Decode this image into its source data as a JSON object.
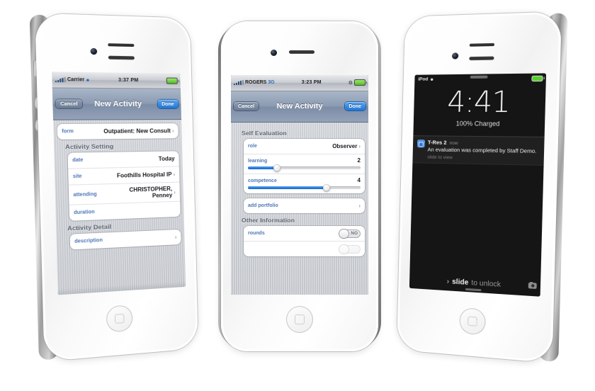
{
  "scene": {
    "title": "Three iPhone 4S mockups showing T-Res 2 app screens",
    "background": "#ffffff"
  },
  "phone_left": {
    "label": "iPhone showing New Activity form",
    "status_bar": {
      "carrier": "Carrier",
      "signal_icon": "signal-bars-icon",
      "wifi_icon": "wifi-icon",
      "time": "3:37 PM",
      "battery_icon": "battery-full-icon"
    },
    "nav": {
      "back_label": "Cancel",
      "title": "New Activity",
      "done_label": "Done"
    },
    "form_row": {
      "key": "form",
      "value": "Outpatient: New Consult",
      "chevron": "chevron-right-icon"
    },
    "sections": [
      {
        "header": "Activity Setting",
        "rows": [
          {
            "badge": "none",
            "key": "date",
            "value": "Today",
            "chevron": false
          },
          {
            "badge": "minus",
            "key": "site",
            "value": "Foothills Hospital IP",
            "chevron": true
          },
          {
            "badge": "minus",
            "key": "attending",
            "value": "CHRISTOPHER, Penney",
            "chevron": true
          },
          {
            "badge": "plus",
            "key": "duration",
            "value": "",
            "chevron": false
          }
        ]
      },
      {
        "header": "Activity Detail",
        "rows": [
          {
            "badge": "plus",
            "key": "description",
            "value": "",
            "chevron": true
          }
        ]
      }
    ]
  },
  "phone_center": {
    "label": "iPhone showing Self Evaluation screen",
    "status_bar": {
      "carrier": "ROGERS",
      "network": "3G",
      "signal_icon": "signal-bars-icon",
      "time": "3:23 PM",
      "bluetooth_icon": "bluetooth-icon",
      "battery_icon": "battery-full-icon"
    },
    "nav": {
      "back_label": "Cancel",
      "title": "New Activity",
      "done_label": "Done"
    },
    "sections": [
      {
        "header": "Self Evaluation",
        "rows": [
          {
            "type": "value",
            "badge": "minus",
            "key": "role",
            "value": "Observer",
            "chevron": true
          },
          {
            "type": "slider",
            "badge": "minus",
            "key": "learning",
            "value": "2",
            "percent": 26
          },
          {
            "type": "slider",
            "badge": "minus",
            "key": "competence",
            "value": "4",
            "percent": 70
          }
        ]
      },
      {
        "header": "",
        "rows": [
          {
            "type": "value",
            "badge": "plus",
            "key": "add portfolio",
            "value": "",
            "chevron": true
          }
        ]
      },
      {
        "header": "Other Information",
        "rows": [
          {
            "type": "switch",
            "badge": "none",
            "key": "rounds",
            "value": "NO"
          }
        ]
      }
    ]
  },
  "phone_right": {
    "label": "iPhone lock screen with notification",
    "status_bar": {
      "device": "iPod",
      "wifi_icon": "wifi-icon",
      "battery_icon": "battery-charging-icon"
    },
    "clock": {
      "time": "4:41",
      "charge_status": "100% Charged"
    },
    "notification": {
      "icon": "t-res-app-icon",
      "app": "T-Res 2",
      "when": "now",
      "message": "An evaluation was completed by Staff Demo.",
      "hint": "slide to view"
    },
    "unlock": {
      "arrow_icon": "chevron-right-icon",
      "bold_word": "slide",
      "rest": "to unlock",
      "camera_icon": "camera-icon"
    }
  },
  "colors": {
    "ios_blue": "#1464c8",
    "key_blue": "#4f78b8",
    "delete_red": "#bf2a20",
    "add_green": "#2f9c26",
    "navbar": "#8c9bb2",
    "screen_bg": "#c3c6cc"
  }
}
